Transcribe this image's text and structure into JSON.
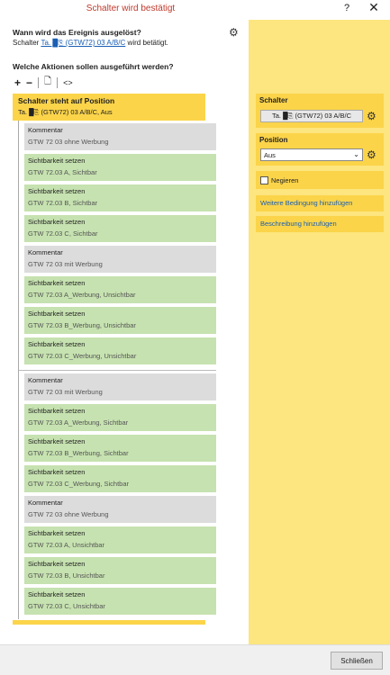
{
  "window": {
    "title": "Schalter wird bestätigt",
    "help": "?",
    "close": "✕"
  },
  "event": {
    "question": "Wann wird das Ereignis ausgelöst?",
    "prefix": "Schalter",
    "link": "Ta. █⎘ (GTW72) 03 A/B/C",
    "suffix": "wird betätigt."
  },
  "actions_heading": "Welche Aktionen sollen ausgeführt werden?",
  "toolbar": {
    "add": "+",
    "remove": "−",
    "doc": "🗋",
    "code": "<>"
  },
  "trigger": {
    "title": "Schalter steht auf Position",
    "detail": "Ta. █⎘ (GTW72) 03 A/B/C, Aus"
  },
  "actions_group1": [
    {
      "type": "comment",
      "title": "Kommentar",
      "detail": "GTW 72 03 ohne Werbung"
    },
    {
      "type": "vis",
      "title": "Sichtbarkeit setzen",
      "detail": "GTW 72.03 A, Sichtbar"
    },
    {
      "type": "vis",
      "title": "Sichtbarkeit setzen",
      "detail": "GTW 72.03 B, Sichtbar"
    },
    {
      "type": "vis",
      "title": "Sichtbarkeit setzen",
      "detail": "GTW 72.03 C, Sichtbar"
    },
    {
      "type": "comment",
      "title": "Kommentar",
      "detail": "GTW 72 03 mit Werbung"
    },
    {
      "type": "vis",
      "title": "Sichtbarkeit setzen",
      "detail": "GTW 72.03 A_Werbung, Unsichtbar"
    },
    {
      "type": "vis",
      "title": "Sichtbarkeit setzen",
      "detail": "GTW 72.03 B_Werbung, Unsichtbar"
    },
    {
      "type": "vis",
      "title": "Sichtbarkeit setzen",
      "detail": "GTW 72.03 C_Werbung, Unsichtbar"
    }
  ],
  "actions_group2": [
    {
      "type": "comment",
      "title": "Kommentar",
      "detail": "GTW 72 03 mit Werbung"
    },
    {
      "type": "vis",
      "title": "Sichtbarkeit setzen",
      "detail": "GTW 72.03 A_Werbung, Sichtbar"
    },
    {
      "type": "vis",
      "title": "Sichtbarkeit setzen",
      "detail": "GTW 72.03 B_Werbung, Sichtbar"
    },
    {
      "type": "vis",
      "title": "Sichtbarkeit setzen",
      "detail": "GTW 72.03 C_Werbung, Sichtbar"
    },
    {
      "type": "comment",
      "title": "Kommentar",
      "detail": "GTW 72 03 ohne Werbung"
    },
    {
      "type": "vis",
      "title": "Sichtbarkeit setzen",
      "detail": "GTW 72.03 A, Unsichtbar"
    },
    {
      "type": "vis",
      "title": "Sichtbarkeit setzen",
      "detail": "GTW 72.03 B, Unsichtbar"
    },
    {
      "type": "vis",
      "title": "Sichtbarkeit setzen",
      "detail": "GTW 72.03 C, Unsichtbar"
    }
  ],
  "panel": {
    "switch_label": "Schalter",
    "switch_value": "Ta. █⎘ (GTW72) 03 A/B/C",
    "position_label": "Position",
    "position_value": "Aus",
    "negate_label": "Negieren",
    "add_condition": "Weitere Bedingung hinzufügen",
    "add_description": "Beschreibung hinzufügen"
  },
  "footer": {
    "close_button": "Schließen"
  },
  "colors": {
    "title": "#c0392b",
    "panel_bg": "#fde57f",
    "accent": "#fbd44a",
    "comment": "#dcdcdc",
    "visibility": "#c6e2b0",
    "link": "#1a5fb4"
  }
}
